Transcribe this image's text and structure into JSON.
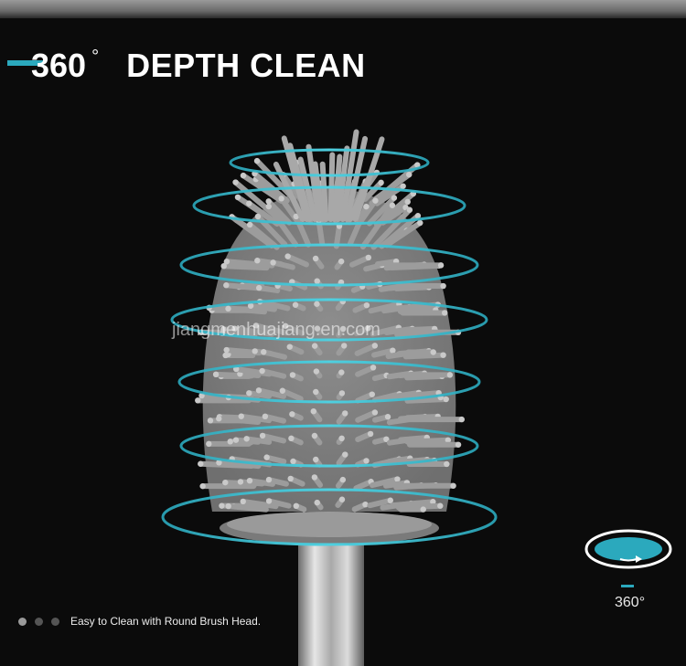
{
  "headline": {
    "degree_value": "360",
    "degree_symbol": "°",
    "text": "DEPTH CLEAN"
  },
  "watermark": "jiangmenhuajiang.en.com",
  "carousel": {
    "dot_count": 3,
    "active_index": 0,
    "caption": "Easy to Clean with Round Brush Head."
  },
  "rotation_badge": {
    "label": "360°",
    "icon": "rotate-360-icon"
  },
  "colors": {
    "accent": "#2ba9bd",
    "background": "#0b0b0b",
    "bristle": "#9b9b9b",
    "handle": "#bdbdbd"
  }
}
